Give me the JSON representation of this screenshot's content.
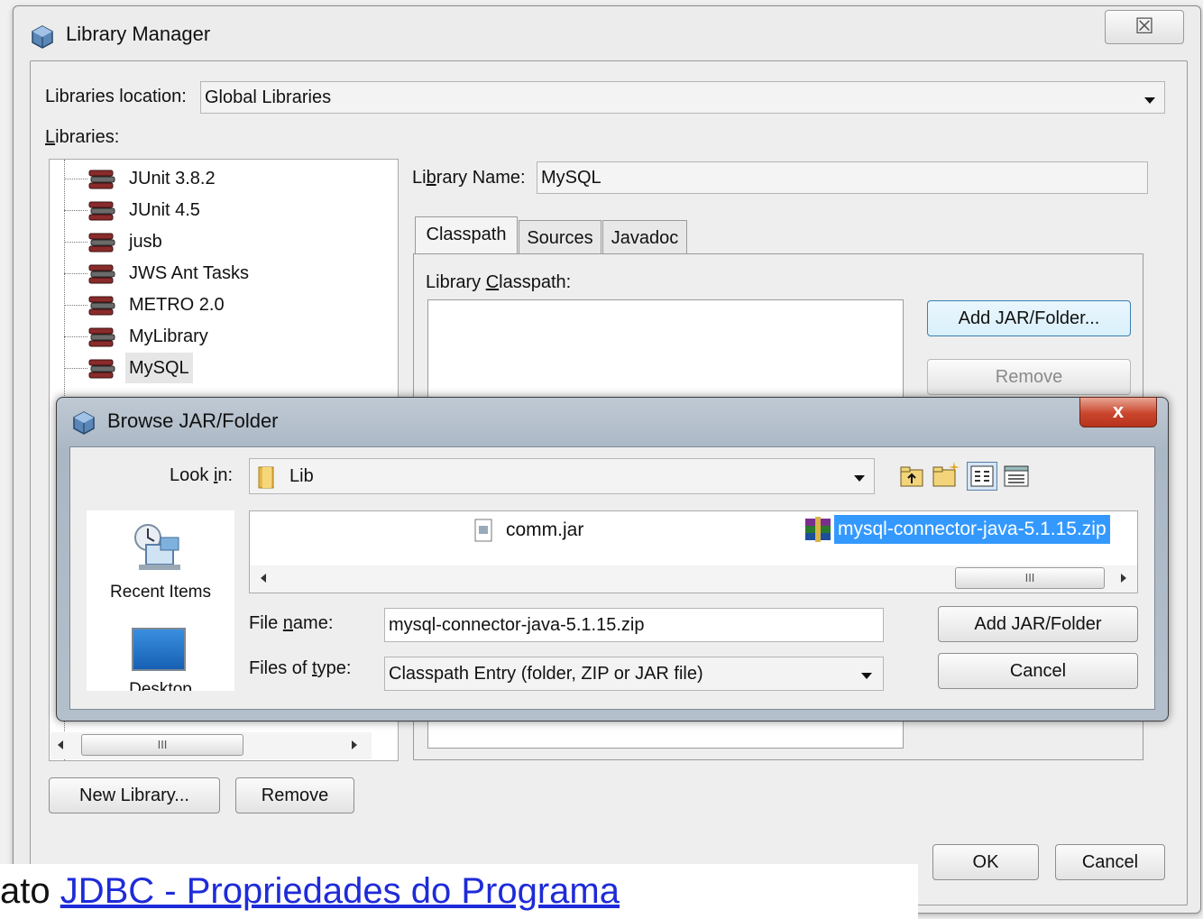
{
  "library_manager": {
    "title": "Library Manager",
    "close_glyph": "☒",
    "location_label": "Libraries location:",
    "location_value": "Global Libraries",
    "libraries_label": "Libraries:",
    "libraries": [
      "JUnit 3.8.2",
      "JUnit 4.5",
      "jusb",
      "JWS Ant Tasks",
      "METRO 2.0",
      "MyLibrary",
      "MySQL"
    ],
    "library_name_label": "Library Name:",
    "library_name_value": "MySQL",
    "tabs": [
      "Classpath",
      "Sources",
      "Javadoc"
    ],
    "classpath_label": "Library Classpath:",
    "add_jar_button": "Add JAR/Folder...",
    "remove_jar_button": "Remove",
    "new_library_button": "New Library...",
    "remove_library_button": "Remove",
    "ok_button": "OK",
    "cancel_button": "Cancel",
    "scroll_thumb": "III"
  },
  "browse_dialog": {
    "title": "Browse JAR/Folder",
    "close_glyph": "x",
    "look_in_label": "Look in:",
    "look_in_value": "Lib",
    "places": [
      "Recent Items",
      "Desktop"
    ],
    "files": [
      {
        "name": "comm.jar",
        "icon": "jar-file-icon",
        "selected": false
      },
      {
        "name": "mysql-connector-java-5.1.15.zip",
        "icon": "winrar-archive-icon",
        "selected": true
      }
    ],
    "file_name_label": "File name:",
    "file_name_value": "mysql-connector-java-5.1.15.zip",
    "files_of_type_label": "Files of type:",
    "files_of_type_value": "Classpath Entry (folder, ZIP or JAR file)",
    "add_button": "Add JAR/Folder",
    "cancel_button": "Cancel",
    "scroll_thumb": "III"
  },
  "footer": {
    "prefix": "ato ",
    "link_text": "JDBC - Propriedades do Programa"
  },
  "colors": {
    "selection": "#3399ff",
    "link": "#1e2bd8",
    "close_red": "#c9452c"
  }
}
